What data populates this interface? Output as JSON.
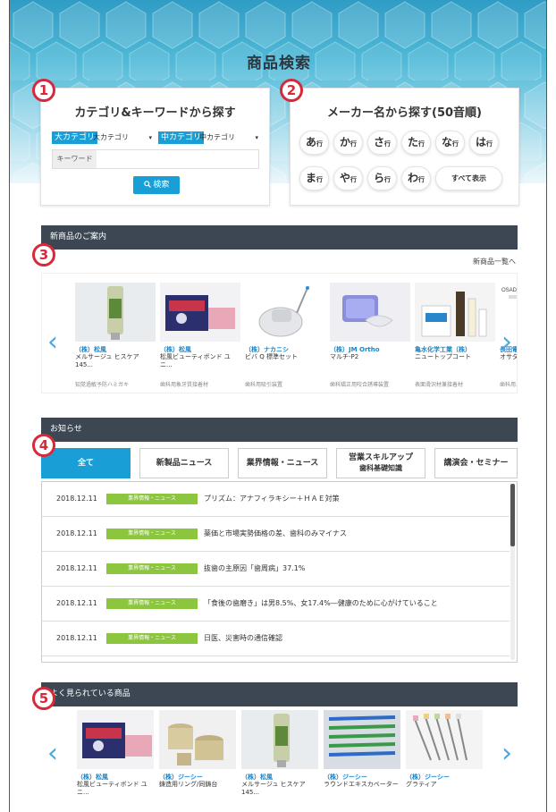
{
  "hero": {
    "title": "商品検索"
  },
  "badges": [
    "1",
    "2",
    "3",
    "4",
    "5"
  ],
  "category_search": {
    "title": "カテゴリ&キーワードから探す",
    "major_label": "大カテゴリ",
    "major_value": "大カテゴリ",
    "middle_label": "中カテゴリ",
    "middle_value": "中カテゴリ",
    "keyword_label": "キーワード",
    "keyword_placeholder": "",
    "search_button": "検索",
    "caret": "▾"
  },
  "maker_search": {
    "title": "メーカー名から探す(50音順)",
    "row_suffix": "行",
    "kana": [
      "あ",
      "か",
      "さ",
      "た",
      "な",
      "は",
      "ま",
      "や",
      "ら",
      "わ"
    ],
    "show_all": "すべて表示"
  },
  "new_products": {
    "header": "新商品のご案内",
    "more_link": "新商品一覧へ",
    "items": [
      {
        "maker": "（株）松風",
        "name": "メルサージュ ヒスケア 145...",
        "category": "知覚過敏予防ハミガキ"
      },
      {
        "maker": "（株）松風",
        "name": "松風ビューティボンド ユ ニ...",
        "category": "歯科用象牙質接着材"
      },
      {
        "maker": "（株）ナカニシ",
        "name": "ビバ Q 標準セット",
        "category": "歯科用吸引装置"
      },
      {
        "maker": "（株）JM Ortho",
        "name": "マルチ-P2",
        "category": "歯科矯正用咬合誘導装置"
      },
      {
        "maker": "亀水化学工業（株）",
        "name": "ニュートップコート",
        "category": "表面滑沢材兼接着材"
      },
      {
        "maker": "長田電機工",
        "name": "オサダベテ",
        "category": "歯科用ユニ"
      }
    ],
    "osada_label": "OSADA Pe"
  },
  "notices": {
    "header": "お知らせ",
    "tabs": [
      "全て",
      "新製品ニュース",
      "業界情報・ニュース",
      "営業スキルアップ 歯科基礎知識",
      "講演会・セミナー"
    ],
    "tab_lines": [
      [
        "全て"
      ],
      [
        "新製品ニュース"
      ],
      [
        "業界情報・ニュース"
      ],
      [
        "営業スキルアップ",
        "歯科基礎知識"
      ],
      [
        "講演会・セミナー"
      ]
    ],
    "items": [
      {
        "date": "2018.12.11",
        "tag": "業界情報・ニュース",
        "text": "プリズム：アナフィラキシー＋ＨＡＥ対策"
      },
      {
        "date": "2018.12.11",
        "tag": "業界情報・ニュース",
        "text": "薬価と市場実勢価格の差、歯科のみマイナス"
      },
      {
        "date": "2018.12.11",
        "tag": "業界情報・ニュース",
        "text": "抜歯の主原因「歯周病」37.1%"
      },
      {
        "date": "2018.12.11",
        "tag": "業界情報・ニュース",
        "text": "「食後の歯磨き」は男8.5%、女17.4%―健康のために心がけていること"
      },
      {
        "date": "2018.12.11",
        "tag": "業界情報・ニュース",
        "text": "日医、災害時の通信確認"
      }
    ]
  },
  "popular": {
    "header": "よく見られている商品",
    "items": [
      {
        "maker": "（株）松風",
        "name": "松風ビューティボンド ユ ニ..."
      },
      {
        "maker": "（株）ジーシー",
        "name": "鋳造用リング/同鋳台"
      },
      {
        "maker": "（株）松風",
        "name": "メルサージュ ヒスケア 145..."
      },
      {
        "maker": "（株）ジーシー",
        "name": "ラウンドエキスカベーター"
      },
      {
        "maker": "（株）ジーシー",
        "name": "グラティア"
      }
    ]
  },
  "arrows": {
    "left": "‹",
    "right": "›"
  },
  "colors": {
    "accent_blue": "#1a9ed6",
    "badge_red": "#d62a3a",
    "news_tag_green": "#8cc63e",
    "section_bar": "#3c4753"
  }
}
